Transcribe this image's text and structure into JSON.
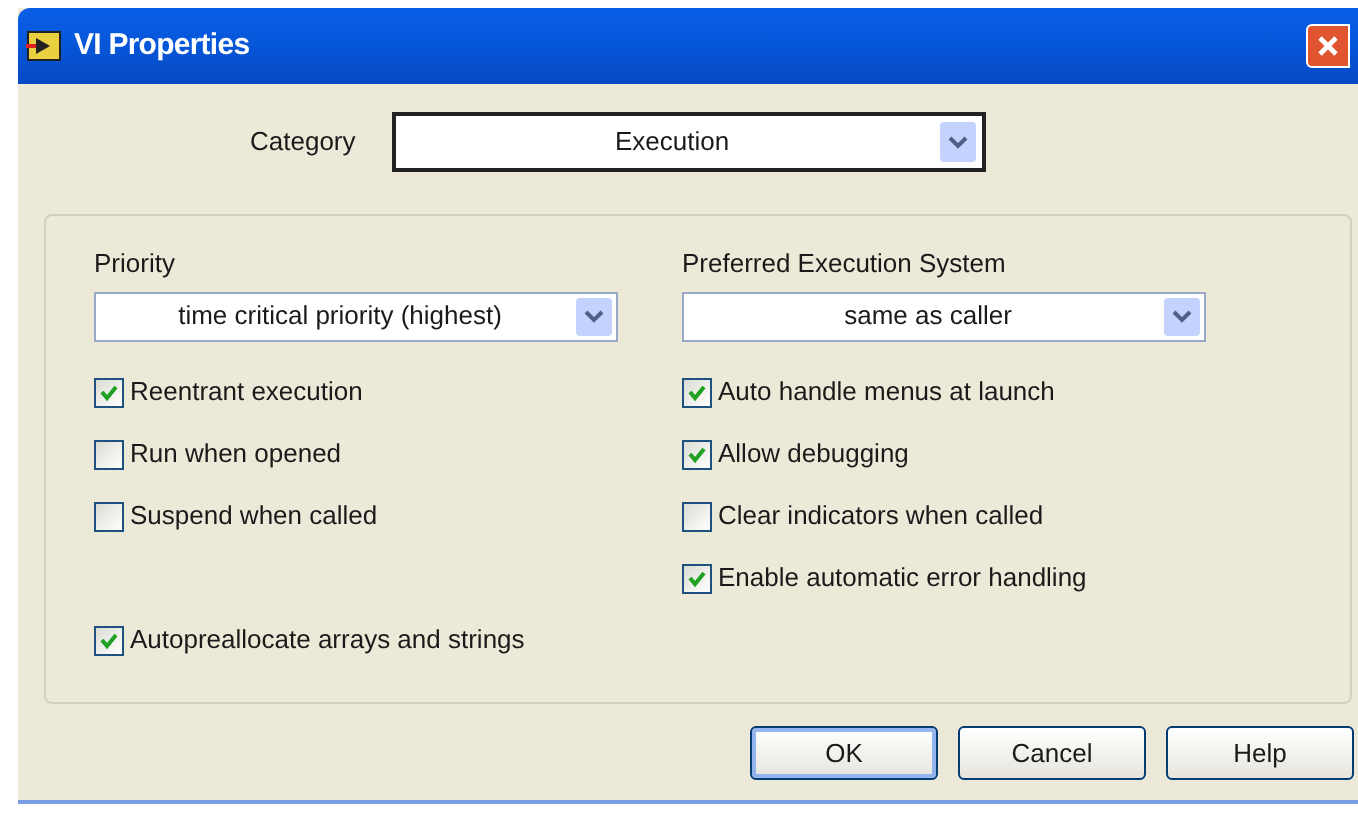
{
  "window": {
    "title": "VI Properties"
  },
  "category": {
    "label": "Category",
    "value": "Execution"
  },
  "left": {
    "label": "Priority",
    "value": "time critical priority (highest)",
    "checkboxes": [
      {
        "label": "Reentrant execution",
        "checked": true
      },
      {
        "label": "Run when opened",
        "checked": false
      },
      {
        "label": "Suspend when called",
        "checked": false
      }
    ]
  },
  "right": {
    "label": "Preferred Execution System",
    "value": "same as caller",
    "checkboxes": [
      {
        "label": "Auto handle menus at launch",
        "checked": true
      },
      {
        "label": "Allow debugging",
        "checked": true
      },
      {
        "label": "Clear indicators when called",
        "checked": false
      },
      {
        "label": "Enable automatic error handling",
        "checked": true
      }
    ]
  },
  "bottom_checkbox": {
    "label": "Autopreallocate arrays and strings",
    "checked": true
  },
  "buttons": [
    {
      "label": "OK",
      "default": true
    },
    {
      "label": "Cancel",
      "default": false
    },
    {
      "label": "Help",
      "default": false
    }
  ]
}
